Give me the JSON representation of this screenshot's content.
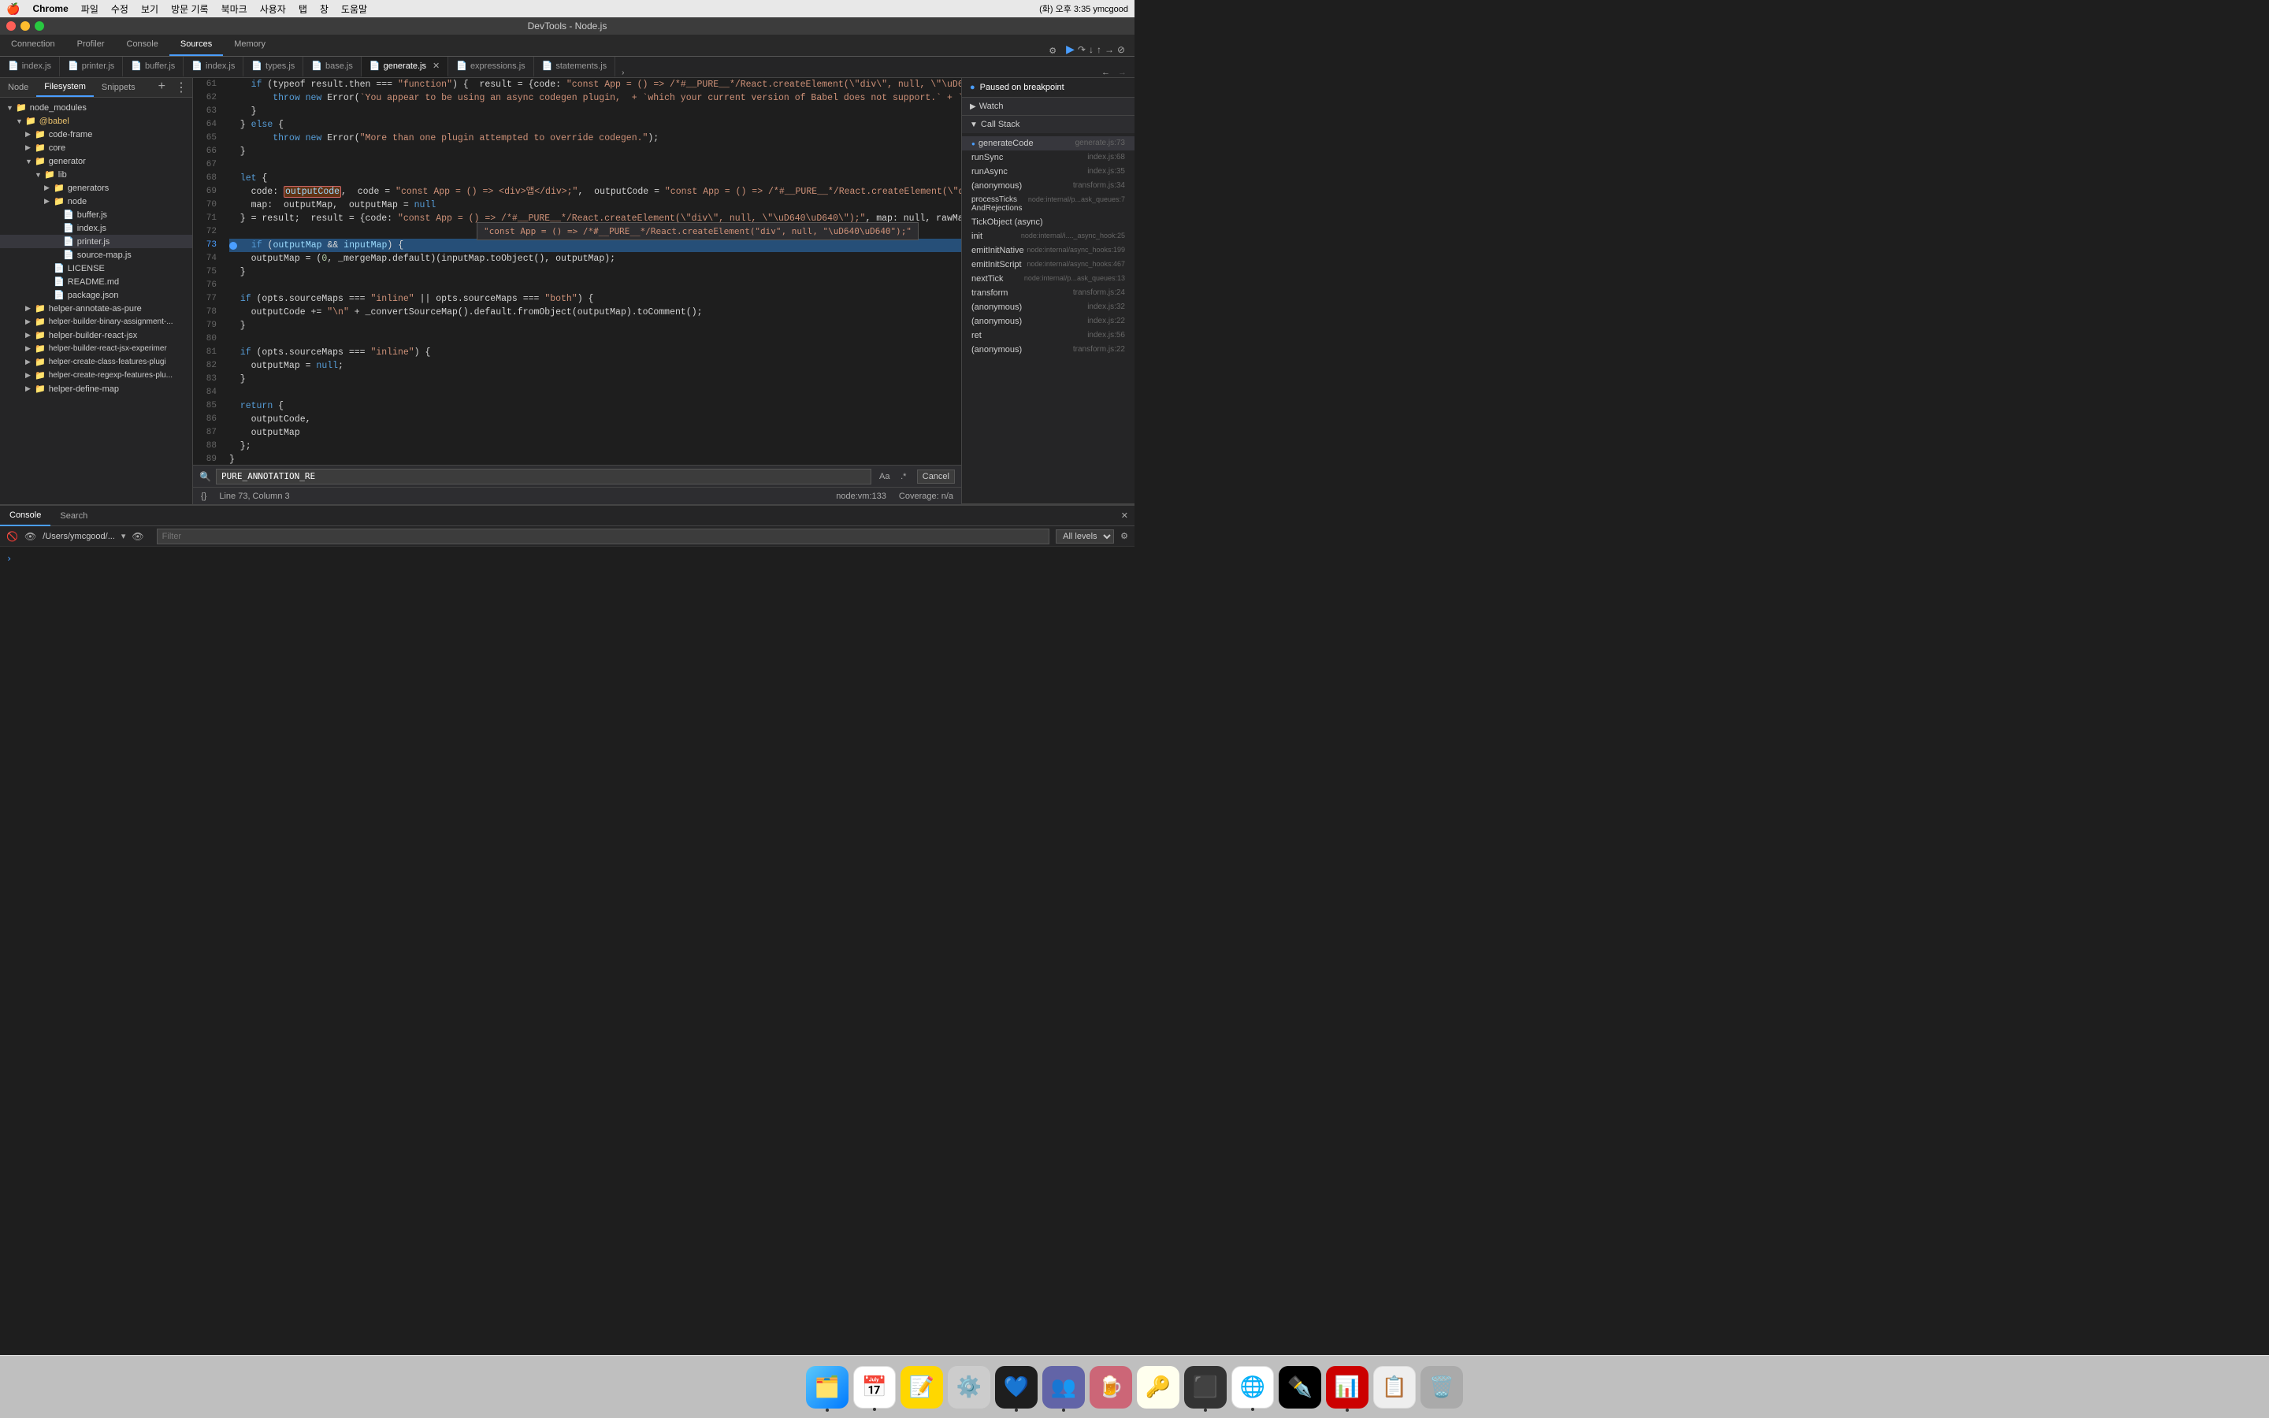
{
  "menubar": {
    "apple": "🍎",
    "items": [
      "Chrome",
      "파일",
      "수정",
      "보기",
      "방문 기록",
      "북마크",
      "사용자",
      "탭",
      "창",
      "도움말"
    ],
    "right": "(화) 오후 3:35  ymcgood"
  },
  "titlebar": {
    "title": "DevTools - Node.js"
  },
  "devtools_tabs": {
    "items": [
      "Connection",
      "Profiler",
      "Console",
      "Sources",
      "Memory"
    ],
    "active": "Sources"
  },
  "toolbar": {
    "pause_resume": "▶",
    "step_over": "↷",
    "step_into": "↓",
    "step_out": "↑",
    "deactivate": "⊘",
    "settings": "⚙"
  },
  "file_tabs": {
    "items": [
      {
        "name": "index.js",
        "active": false,
        "icon": "📄"
      },
      {
        "name": "printer.js",
        "active": false,
        "icon": "📄"
      },
      {
        "name": "buffer.js",
        "active": false,
        "icon": "📄"
      },
      {
        "name": "index.js",
        "active": false,
        "icon": "📄"
      },
      {
        "name": "types.js",
        "active": false,
        "icon": "📄"
      },
      {
        "name": "base.js",
        "active": false,
        "icon": "📄"
      },
      {
        "name": "generate.js",
        "active": true,
        "icon": "📄"
      },
      {
        "name": "expressions.js",
        "active": false,
        "icon": "📄"
      },
      {
        "name": "statements.js",
        "active": false,
        "icon": "📄"
      }
    ],
    "more": "›"
  },
  "left_panel": {
    "tabs": [
      "Node",
      "Filesystem",
      "Snippets"
    ],
    "active_tab": "Filesystem",
    "tree": [
      {
        "type": "folder",
        "name": "node_modules",
        "level": 0,
        "expanded": true
      },
      {
        "type": "folder",
        "name": "@babel",
        "level": 1,
        "expanded": true
      },
      {
        "type": "folder",
        "name": "code-frame",
        "level": 2,
        "expanded": false
      },
      {
        "type": "folder",
        "name": "core",
        "level": 2,
        "expanded": false
      },
      {
        "type": "folder",
        "name": "generator",
        "level": 2,
        "expanded": true
      },
      {
        "type": "folder",
        "name": "lib",
        "level": 3,
        "expanded": true
      },
      {
        "type": "folder",
        "name": "generators",
        "level": 4,
        "expanded": false
      },
      {
        "type": "folder",
        "name": "node",
        "level": 4,
        "expanded": false
      },
      {
        "type": "file",
        "name": "buffer.js",
        "level": 4
      },
      {
        "type": "file",
        "name": "index.js",
        "level": 4
      },
      {
        "type": "file",
        "name": "printer.js",
        "level": 4,
        "active": true
      },
      {
        "type": "file",
        "name": "source-map.js",
        "level": 4
      },
      {
        "type": "file",
        "name": "LICENSE",
        "level": 3
      },
      {
        "type": "file",
        "name": "README.md",
        "level": 3
      },
      {
        "type": "file",
        "name": "package.json",
        "level": 3
      },
      {
        "type": "folder",
        "name": "helper-annotate-as-pure",
        "level": 2,
        "expanded": false
      },
      {
        "type": "folder",
        "name": "helper-builder-binary-assignment-...",
        "level": 2,
        "expanded": false
      },
      {
        "type": "folder",
        "name": "helper-builder-react-jsx",
        "level": 2,
        "expanded": false
      },
      {
        "type": "folder",
        "name": "helper-builder-react-jsx-experimer",
        "level": 2,
        "expanded": false
      },
      {
        "type": "folder",
        "name": "helper-create-class-features-plugi",
        "level": 2,
        "expanded": false
      },
      {
        "type": "folder",
        "name": "helper-create-regexp-features-plu...",
        "level": 2,
        "expanded": false
      },
      {
        "type": "folder",
        "name": "helper-define-map",
        "level": 2,
        "expanded": false
      }
    ]
  },
  "code_editor": {
    "lines": [
      {
        "num": 61,
        "text": "    if (typeof result.then === \"function\") {  result = {code: \"const App = () => /*#__PURE__*/React.createElement(\\\"div\\\", null, \\\"\\uD640\\uL\\\"",
        "highlighted": false
      },
      {
        "num": 62,
        "text": "        throw new Error(`You appear to be using an async codegen plugin,  + `which your current version of Babel does not support.` + `If",
        "highlighted": false
      },
      {
        "num": 63,
        "text": "    }",
        "highlighted": false
      },
      {
        "num": 64,
        "text": "  } else {",
        "highlighted": false
      },
      {
        "num": 65,
        "text": "        throw new Error(\"More than one plugin attempted to override codegen.\");",
        "highlighted": false
      },
      {
        "num": 66,
        "text": "  }",
        "highlighted": false
      },
      {
        "num": 67,
        "text": "",
        "highlighted": false
      },
      {
        "num": 68,
        "text": "  let {",
        "highlighted": false
      },
      {
        "num": 69,
        "text": "    code: outputCode,  code = \"const App = () => <div>앱</div>;\",  outputCode = \"const App = () => /*#__PURE__*/React.createElement(\\\"di",
        "highlighted": false
      },
      {
        "num": 70,
        "text": "    map:  outputMap,  outputMap = null",
        "highlighted": false
      },
      {
        "num": 71,
        "text": "  } = result;  result = {code: \"const App = () => /*#__PURE__*/React.createElement(\\\"div\\\", null, \\\"\\uD640\\uD640\\\");\", map: null, rawMapping",
        "highlighted": false
      },
      {
        "num": 72,
        "text": "",
        "highlighted": false
      },
      {
        "num": 73,
        "text": "  if (outputMap && inputMap) {",
        "highlighted": true,
        "breakpoint": true
      },
      {
        "num": 74,
        "text": "    outputMap = (0, _mergeMap.default)(inputMap.toObject(), outputMap);",
        "highlighted": false
      },
      {
        "num": 75,
        "text": "  }",
        "highlighted": false
      },
      {
        "num": 76,
        "text": "",
        "highlighted": false
      },
      {
        "num": 77,
        "text": "  if (opts.sourceMaps === \"inline\" || opts.sourceMaps === \"both\") {",
        "highlighted": false
      },
      {
        "num": 78,
        "text": "    outputCode += \"\\n\" + _convertSourceMap().default.fromObject(outputMap).toComment();",
        "highlighted": false
      },
      {
        "num": 79,
        "text": "  }",
        "highlighted": false
      },
      {
        "num": 80,
        "text": "",
        "highlighted": false
      },
      {
        "num": 81,
        "text": "  if (opts.sourceMaps === \"inline\") {",
        "highlighted": false
      },
      {
        "num": 82,
        "text": "    outputMap = null;",
        "highlighted": false
      },
      {
        "num": 83,
        "text": "  }",
        "highlighted": false
      },
      {
        "num": 84,
        "text": "",
        "highlighted": false
      },
      {
        "num": 85,
        "text": "  return {",
        "highlighted": false
      },
      {
        "num": 86,
        "text": "    outputCode,",
        "highlighted": false
      },
      {
        "num": 87,
        "text": "    outputMap",
        "highlighted": false
      },
      {
        "num": 88,
        "text": "  };",
        "highlighted": false
      },
      {
        "num": 89,
        "text": "}",
        "highlighted": false
      }
    ],
    "tooltip": "\"const App = () => /*#__PURE__*/React.createElement(\\\"div\\\", null, \\\"\\uD640\\uD640\\\");\"",
    "search_value": "PURE_ANNOTATION_RE",
    "status": "Line 73, Column 3",
    "node_vm": "node:vm:133",
    "coverage": "Coverage: n/a"
  },
  "right_panel": {
    "paused": "Paused on breakpoint",
    "watch_label": "Watch",
    "call_stack_label": "Call Stack",
    "call_stack": [
      {
        "fn": "generateCode",
        "file": "generate.js:73",
        "active": true,
        "blue_dot": true
      },
      {
        "fn": "runSync",
        "file": "index.js:68"
      },
      {
        "fn": "runAsync",
        "file": "index.js:35"
      },
      {
        "fn": "(anonymous)",
        "file": "transform.js:34"
      },
      {
        "fn": "processTicks​AndRejections",
        "file": "node:internal/p...ask_queues:7"
      },
      {
        "fn": "TickObject (async)",
        "file": ""
      },
      {
        "fn": "init",
        "file": "node:internal/i...._async_hook:25"
      },
      {
        "fn": "emitInitNative",
        "file": "node:internal/async_hooks:199"
      },
      {
        "fn": "emitInitScript",
        "file": "node:internal/async_hooks:467"
      },
      {
        "fn": "nextTick",
        "file": "node:internal/p...ask_queues:13"
      },
      {
        "fn": "transform",
        "file": "transform.js:24"
      },
      {
        "fn": "(anonymous)",
        "file": "index.js:32"
      },
      {
        "fn": "(anonymous)",
        "file": "index.js:22"
      },
      {
        "fn": "ret",
        "file": "index.js:56"
      },
      {
        "fn": "(anonymous)",
        "file": "transform.js:22"
      }
    ]
  },
  "bottom_panel": {
    "tabs": [
      "Console",
      "Search"
    ],
    "active_tab": "Console",
    "toolbar": {
      "path": "/Users/ymcgood/...",
      "filter_placeholder": "Filter",
      "levels": "All levels"
    }
  },
  "dock": {
    "items": [
      {
        "name": "Finder",
        "emoji": "🗂️",
        "bg": "#5ac8fa"
      },
      {
        "name": "Calendar",
        "emoji": "📅",
        "bg": "#fff"
      },
      {
        "name": "Notes",
        "emoji": "📝",
        "bg": "#ffd700"
      },
      {
        "name": "System Preferences",
        "emoji": "⚙️",
        "bg": "#888"
      },
      {
        "name": "VS Code",
        "emoji": "💙",
        "bg": "#1e1e1e"
      },
      {
        "name": "Teams",
        "emoji": "🟣",
        "bg": "#6264a7"
      },
      {
        "name": "Epichrome",
        "emoji": "🍺",
        "bg": "#c67"
      },
      {
        "name": "Keychain",
        "emoji": "🔑",
        "bg": "#ffd"
      },
      {
        "name": "Terminal",
        "emoji": "⬛",
        "bg": "#333"
      },
      {
        "name": "Chrome",
        "emoji": "🌐",
        "bg": "#fff"
      },
      {
        "name": "Vectornator",
        "emoji": "✒️",
        "bg": "#000"
      },
      {
        "name": "PowerPoint",
        "emoji": "📊",
        "bg": "#c00"
      },
      {
        "name": "Clipboard",
        "emoji": "📋",
        "bg": "#eee"
      },
      {
        "name": "Trash",
        "emoji": "🗑️",
        "bg": "#aaa"
      }
    ]
  }
}
